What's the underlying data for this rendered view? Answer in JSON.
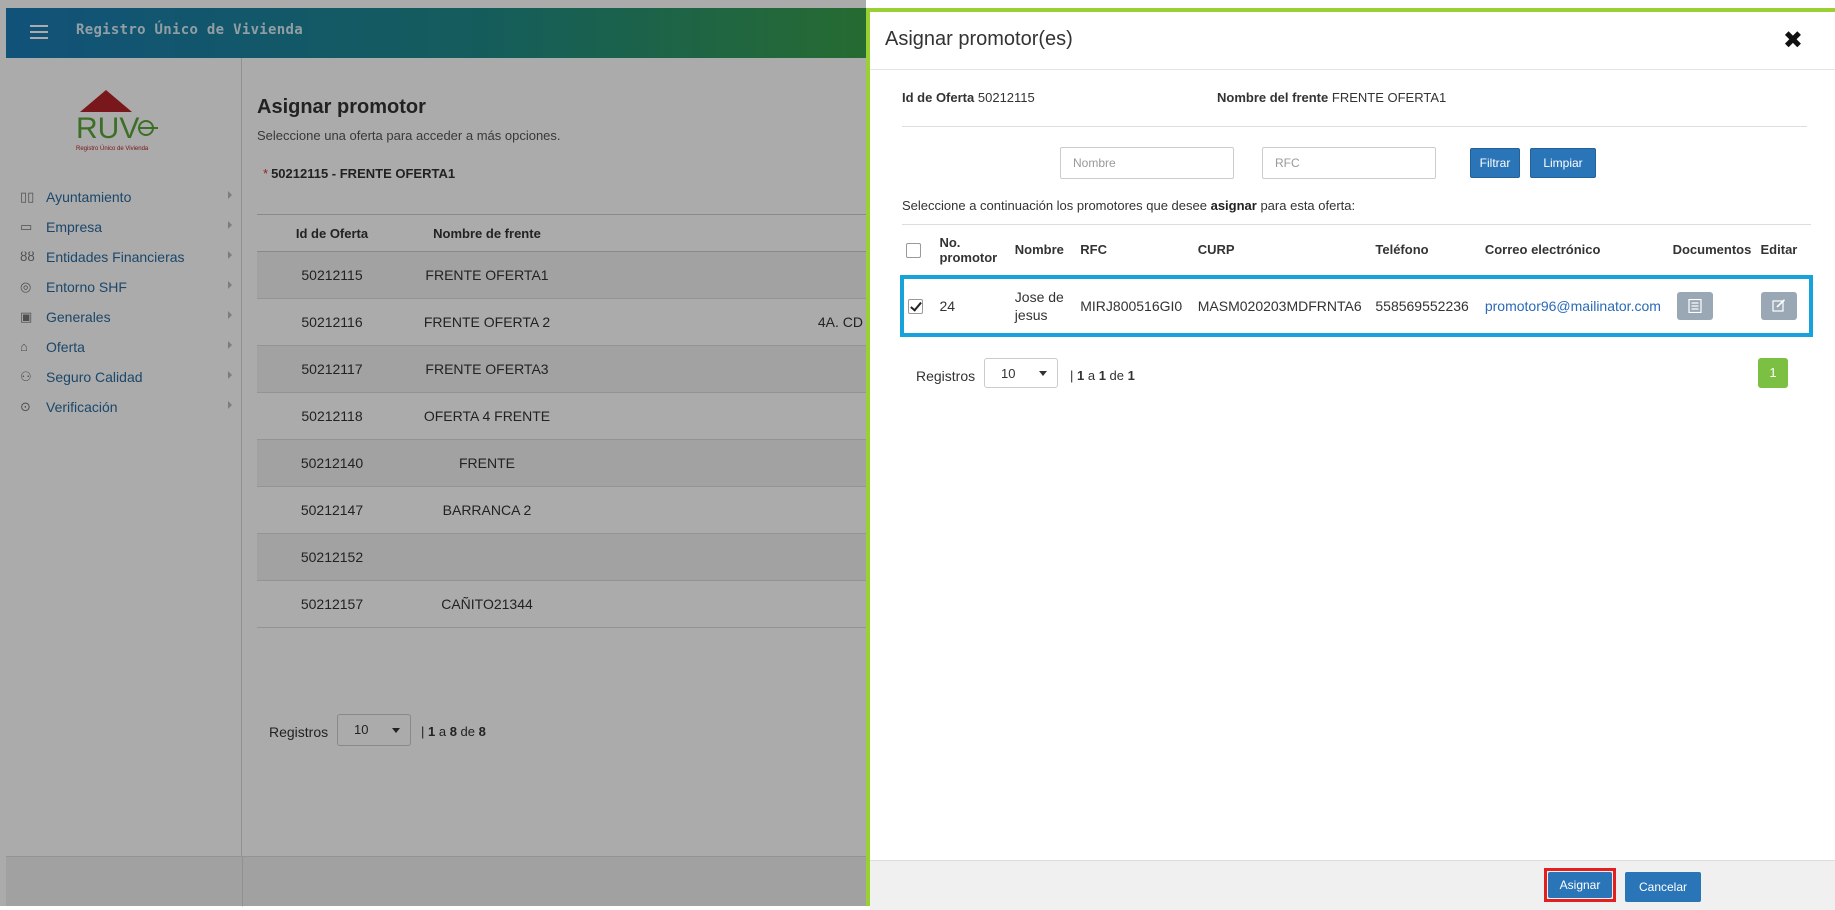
{
  "app": {
    "title": "Registro Único de Vivienda",
    "logo_text": "RUV",
    "logo_subtext": "Registro Único de Vivienda"
  },
  "sidebar": {
    "items": [
      {
        "label": "Ayuntamiento",
        "icon": "map-icon"
      },
      {
        "label": "Empresa",
        "icon": "building-icon"
      },
      {
        "label": "Entidades Financieras",
        "icon": "people-icon"
      },
      {
        "label": "Entorno SHF",
        "icon": "target-icon"
      },
      {
        "label": "Generales",
        "icon": "document-icon"
      },
      {
        "label": "Oferta",
        "icon": "house-icon"
      },
      {
        "label": "Seguro Calidad",
        "icon": "handshake-icon"
      },
      {
        "label": "Verificación",
        "icon": "check-circle-icon"
      }
    ]
  },
  "main": {
    "title": "Asignar promotor",
    "subtitle": "Seleccione una oferta para acceder a más opciones.",
    "selected_offer": "50212115 - FRENTE OFERTA1",
    "required_mark": "*",
    "table": {
      "headers": [
        "Id de Oferta",
        "Nombre de frente"
      ],
      "rows": [
        {
          "id": "50212115",
          "name": "FRENTE OFERTA1",
          "extra": ""
        },
        {
          "id": "50212116",
          "name": "FRENTE OFERTA 2",
          "extra": "4A. CD"
        },
        {
          "id": "50212117",
          "name": "FRENTE OFERTA3",
          "extra": ""
        },
        {
          "id": "50212118",
          "name": "OFERTA 4 FRENTE",
          "extra": ""
        },
        {
          "id": "50212140",
          "name": "FRENTE",
          "extra": ""
        },
        {
          "id": "50212147",
          "name": "BARRANCA 2",
          "extra": ""
        },
        {
          "id": "50212152",
          "name": "",
          "extra": ""
        },
        {
          "id": "50212157",
          "name": "CAÑITO21344",
          "extra": ""
        }
      ]
    },
    "pager": {
      "label": "Registros",
      "per_page": "10",
      "info_prefix": "| ",
      "from": "1",
      "sep1": " a ",
      "to": "8",
      "sep2": " de ",
      "total": "8"
    }
  },
  "modal": {
    "title": "Asignar promotor(es)",
    "close": "✖",
    "offer_id_label": "Id de Oferta",
    "offer_id_value": "50212115",
    "front_label": "Nombre del frente",
    "front_value": "FRENTE OFERTA1",
    "filter": {
      "name_placeholder": "Nombre",
      "rfc_placeholder": "RFC",
      "filter_button": "Filtrar",
      "clear_button": "Limpiar"
    },
    "instructions_pre": "Seleccione a continuación los promotores que desee ",
    "instructions_bold": "asignar",
    "instructions_post": " para esta oferta:",
    "table": {
      "headers": [
        "No. promotor",
        "Nombre",
        "RFC",
        "CURP",
        "Teléfono",
        "Correo electrónico",
        "Documentos",
        "Editar"
      ],
      "rows": [
        {
          "checked": true,
          "no": "24",
          "nombre": "Jose de jesus",
          "rfc": "MIRJ800516GI0",
          "curp": "MASM020203MDFRNTA6",
          "telefono": "558569552236",
          "correo": "promotor96@mailinator.com"
        }
      ]
    },
    "pager": {
      "label": "Registros",
      "per_page": "10",
      "info_prefix": "| ",
      "from": "1",
      "sep1": " a ",
      "to": "1",
      "sep2": " de ",
      "total": "1",
      "current_page": "1"
    },
    "footer": {
      "assign_button": "Asignar",
      "cancel_button": "Cancelar"
    }
  },
  "colors": {
    "modal_accent": "#9ad034",
    "selected_row_border": "#17a2dc",
    "primary_button": "#2a74b8",
    "highlight_border": "#e32020",
    "page_button": "#7cc043"
  }
}
